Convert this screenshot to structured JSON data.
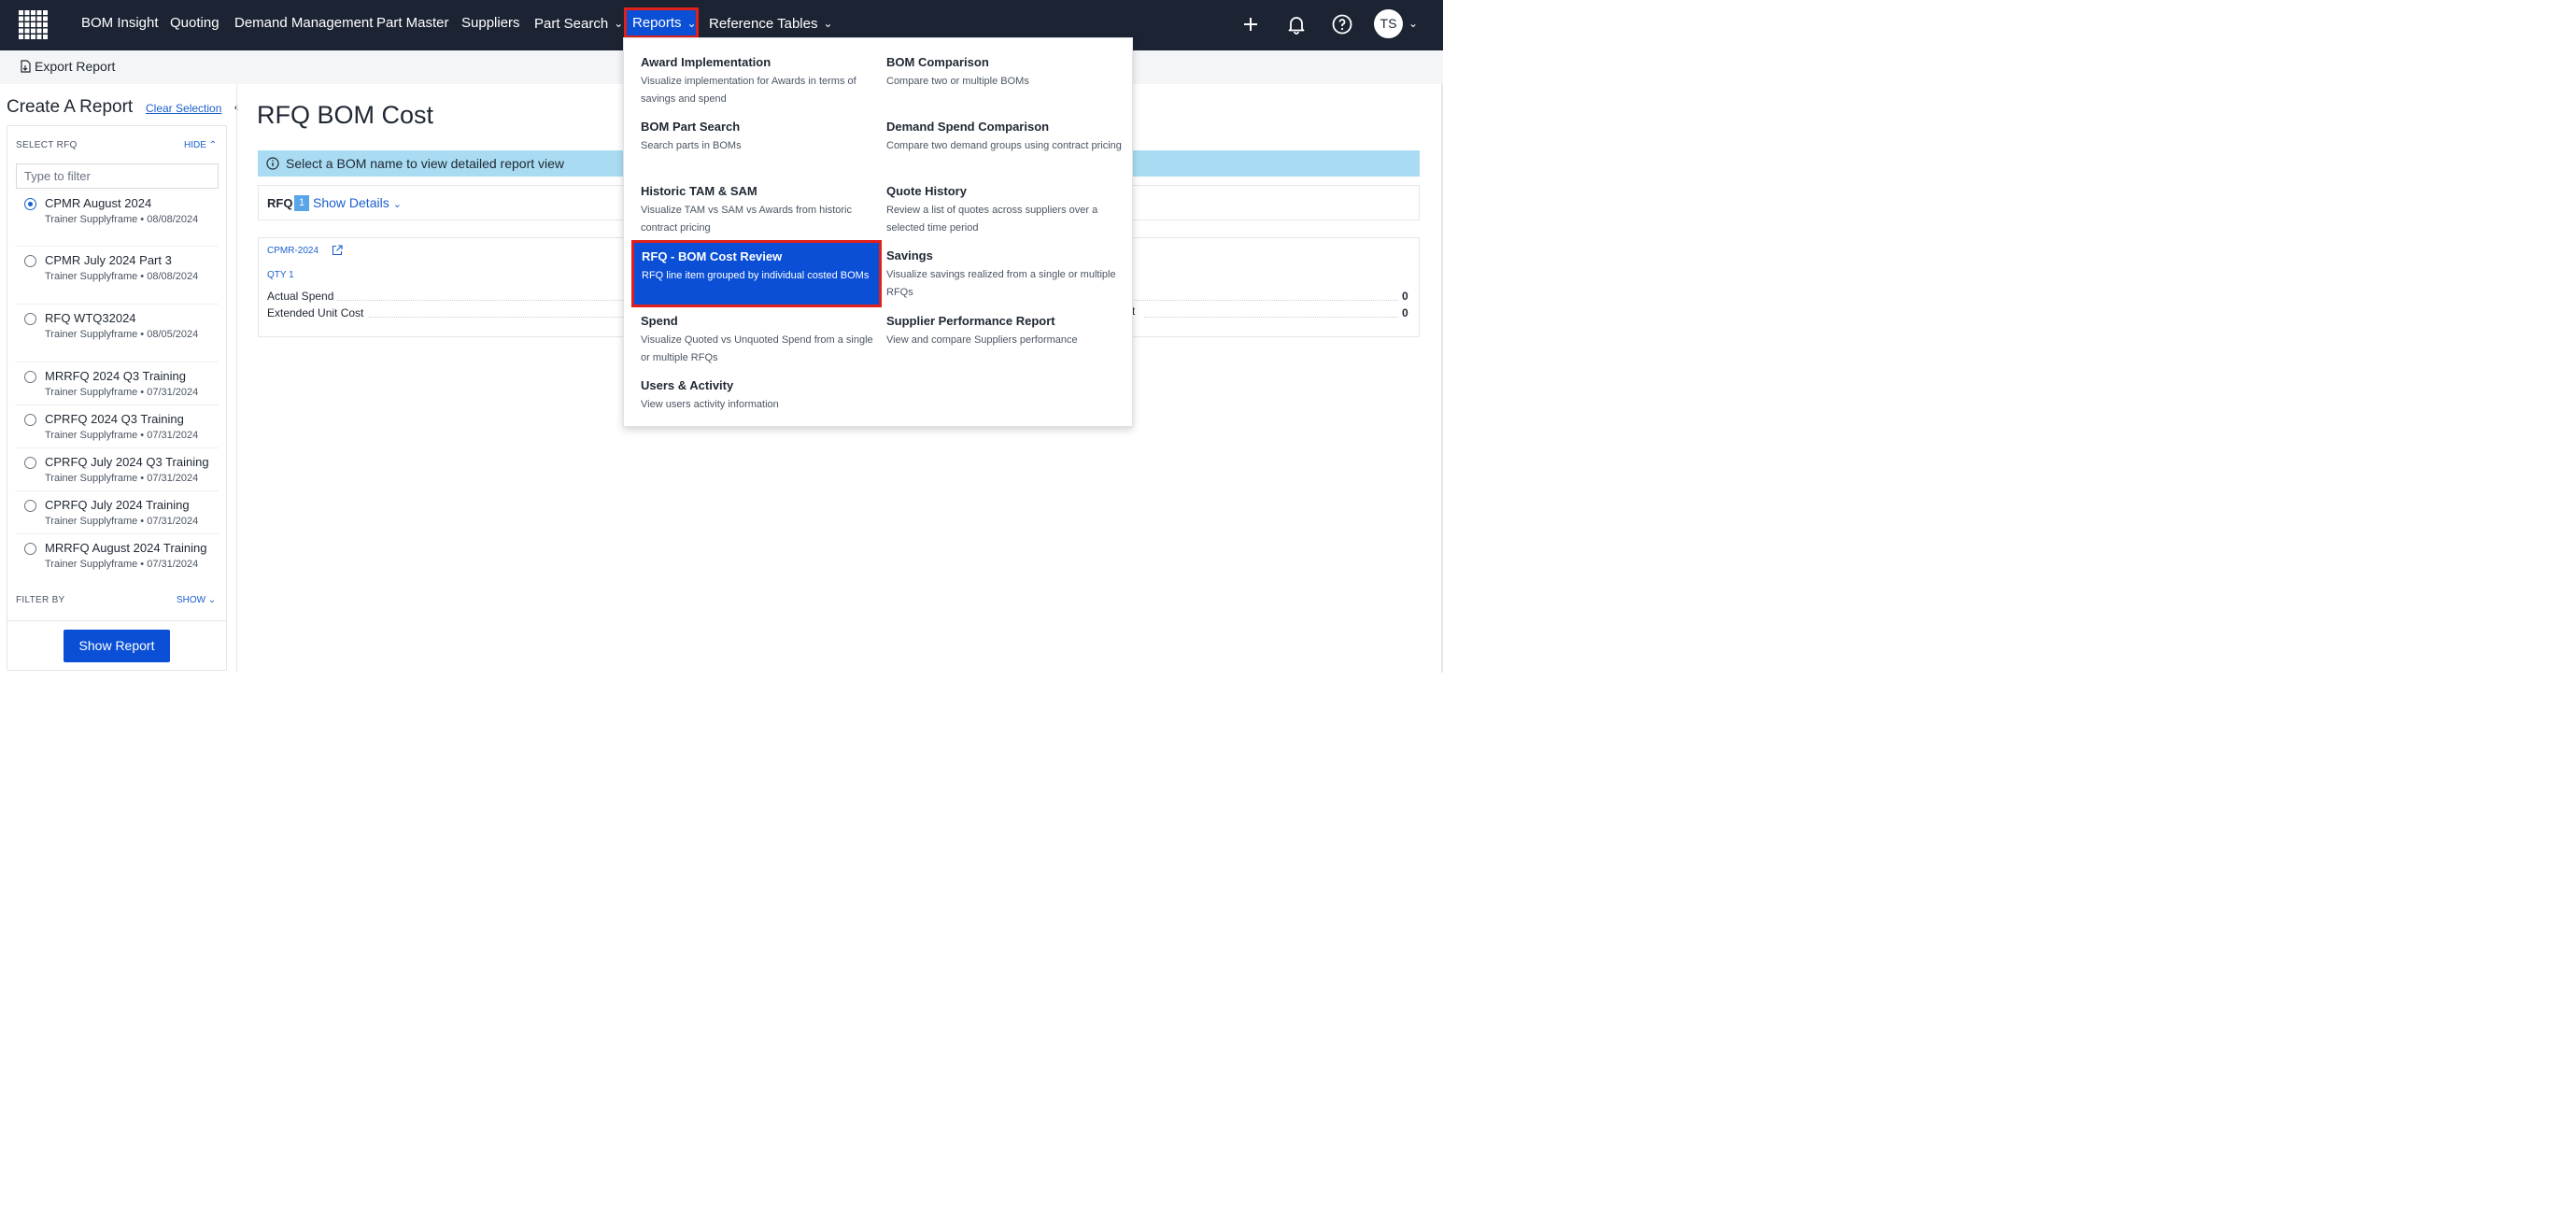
{
  "nav": {
    "items": [
      "BOM Insight",
      "Quoting",
      "Demand Management",
      "Part Master",
      "Suppliers",
      "Part Search"
    ],
    "reports": "Reports",
    "reference_tables": "Reference Tables",
    "user_initials": "TS"
  },
  "toolbar": {
    "export_label": "Export Report"
  },
  "sidebar": {
    "title": "Create A Report",
    "clear_selection": "Clear Selection",
    "select_rfq_label": "SELECT RFQ",
    "hide_label": "HIDE",
    "filter_placeholder": "Type to filter",
    "rfqs": [
      {
        "name": "CPMR August 2024",
        "sub": "Trainer Supplyframe • 08/08/2024",
        "selected": true
      },
      {
        "name": "CPMR July 2024 Part 3",
        "sub": "Trainer Supplyframe • 08/08/2024",
        "selected": false
      },
      {
        "name": "RFQ WTQ32024",
        "sub": "Trainer Supplyframe • 08/05/2024",
        "selected": false
      },
      {
        "name": "MRRFQ 2024 Q3 Training",
        "sub": "Trainer Supplyframe • 07/31/2024",
        "selected": false
      },
      {
        "name": "CPRFQ 2024 Q3 Training",
        "sub": "Trainer Supplyframe • 07/31/2024",
        "selected": false
      },
      {
        "name": "CPRFQ July 2024 Q3 Training",
        "sub": "Trainer Supplyframe • 07/31/2024",
        "selected": false
      },
      {
        "name": "CPRFQ July 2024 Training",
        "sub": "Trainer Supplyframe • 07/31/2024",
        "selected": false
      },
      {
        "name": "MRRFQ August 2024 Training",
        "sub": "Trainer Supplyframe • 07/31/2024",
        "selected": false
      }
    ],
    "filter_by_label": "FILTER BY",
    "show_label": "SHOW",
    "show_report_button": "Show Report"
  },
  "main": {
    "title": "RFQ BOM Cost",
    "info_text": "Select a BOM name to view detailed report view",
    "rfq_label": "RFQ",
    "rfq_count": "1",
    "show_details": "Show Details",
    "bom_name": "CPMR-2024",
    "qty_label": "QTY 1",
    "metrics": [
      {
        "label": "Actual Spend",
        "value": "0"
      },
      {
        "label": "Extended Unit Cost",
        "value": "0"
      }
    ],
    "clipped_text": "st"
  },
  "reports_menu": {
    "left": [
      {
        "title": "Award Implementation",
        "desc": "Visualize implementation for Awards in terms of savings and spend"
      },
      {
        "title": "BOM Part Search",
        "desc": "Search parts in BOMs"
      },
      {
        "title": "Historic TAM & SAM",
        "desc": "Visualize TAM vs SAM vs Awards from historic contract pricing"
      },
      {
        "title": "RFQ - BOM Cost Review",
        "desc": "RFQ line item grouped by individual costed BOMs"
      },
      {
        "title": "Spend",
        "desc": "Visualize Quoted vs Unquoted Spend from a single or multiple RFQs"
      },
      {
        "title": "Users & Activity",
        "desc": "View users activity information"
      }
    ],
    "right": [
      {
        "title": "BOM Comparison",
        "desc": "Compare two or multiple BOMs"
      },
      {
        "title": "Demand Spend Comparison",
        "desc": "Compare two demand groups using contract pricing"
      },
      {
        "title": "Quote History",
        "desc": "Review a list of quotes across suppliers over a selected time period"
      },
      {
        "title": "Savings",
        "desc": "Visualize savings realized from a single or multiple RFQs"
      },
      {
        "title": "Supplier Performance Report",
        "desc": "View and compare Suppliers performance"
      }
    ]
  },
  "colors": {
    "nav_bg": "#1c2434",
    "accent": "#0a4fd6",
    "highlight": "#e0201b",
    "info_bg": "#a9dcf2"
  }
}
